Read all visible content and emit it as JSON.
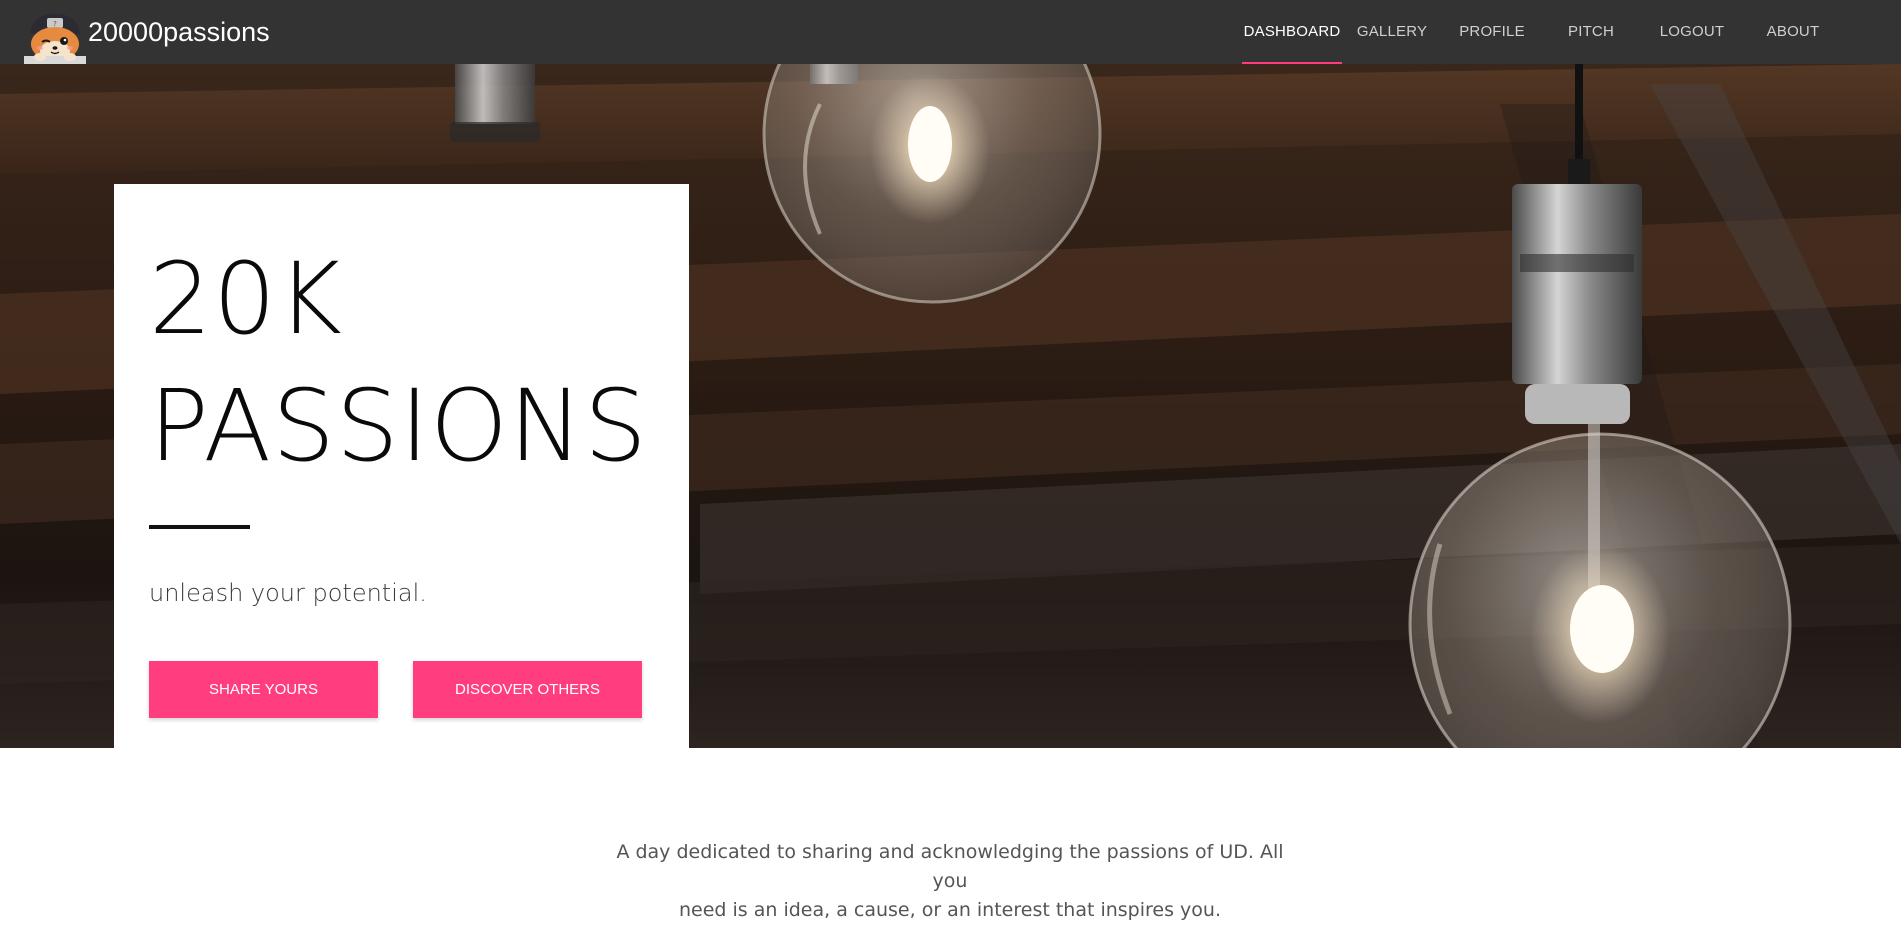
{
  "brand": {
    "name": "20000passions",
    "logo_icon": "shiba-mascot-logo-icon"
  },
  "nav": {
    "items": [
      {
        "label": "DASHBOARD",
        "active": true
      },
      {
        "label": "GALLERY",
        "active": false
      },
      {
        "label": "PROFILE",
        "active": false
      },
      {
        "label": "PITCH",
        "active": false
      },
      {
        "label": "LOGOUT",
        "active": false
      },
      {
        "label": "ABOUT",
        "active": false
      }
    ]
  },
  "hero": {
    "background": "hanging-edison-light-bulbs",
    "title_line1": "20K",
    "title_line2": "PASSIONS",
    "subtitle": "unleash your potential.",
    "primary_button": "SHARE YOURS",
    "secondary_button": "DISCOVER OTHERS"
  },
  "intro": {
    "line1": "A day dedicated to sharing and acknowledging the passions of UD. All you",
    "line2": "need is an idea, a cause, or an interest that inspires you."
  },
  "colors": {
    "navbar": "#333333",
    "accent": "#ff3d7f",
    "nav_active": "#ffffff",
    "nav_text": "#cfcfcf"
  }
}
